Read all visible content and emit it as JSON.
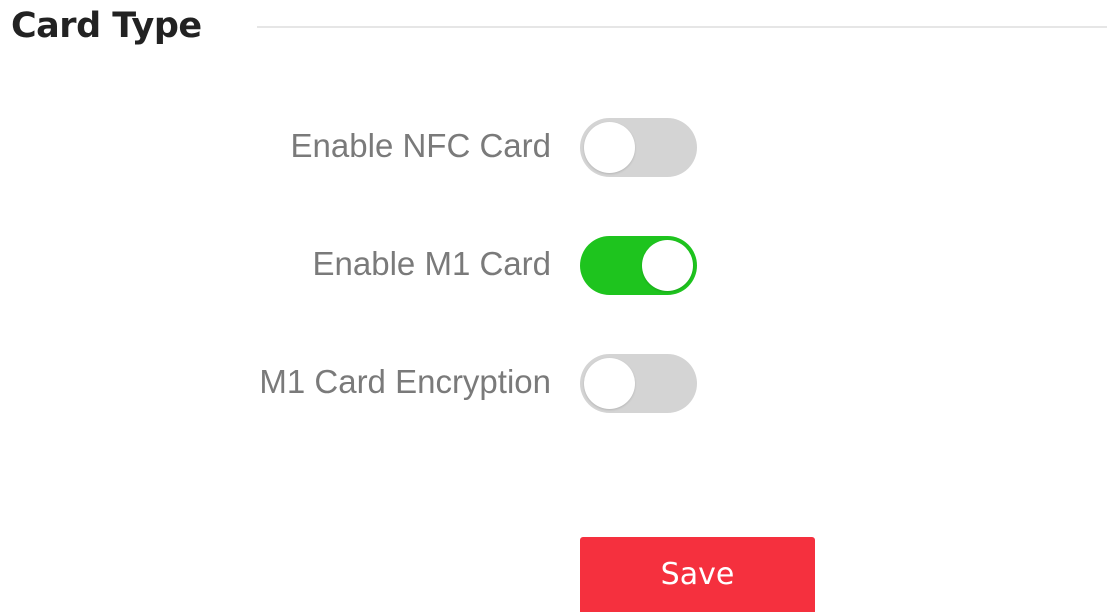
{
  "section": {
    "title": "Card Type"
  },
  "settings": [
    {
      "label": "Enable NFC Card",
      "enabled": false
    },
    {
      "label": "Enable M1 Card",
      "enabled": true
    },
    {
      "label": "M1 Card Encryption",
      "enabled": false
    }
  ],
  "actions": {
    "save_label": "Save"
  },
  "colors": {
    "toggle_on": "#1ec41e",
    "toggle_off": "#d4d4d4",
    "save_button": "#f5303e"
  }
}
